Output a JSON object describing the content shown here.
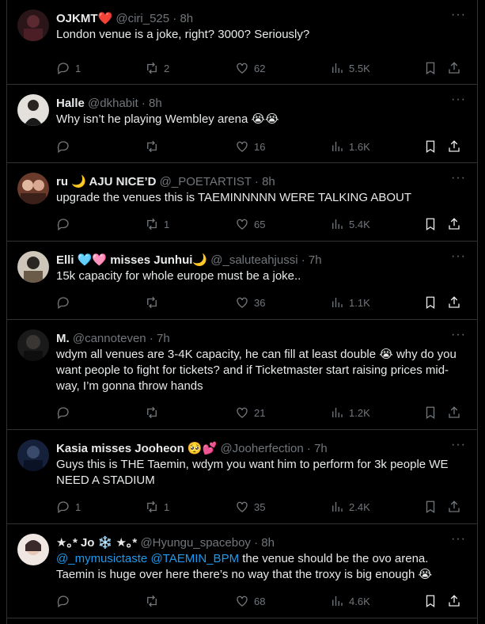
{
  "colors": {
    "background": "#000000",
    "accent": "#1d9bf0",
    "muted": "#71767b",
    "text": "#e7e9ea"
  },
  "more_label": "···",
  "tweets": [
    {
      "name": "OJKMT",
      "name_emoji": "❤️",
      "handle": "@ciri_525",
      "dot": "·",
      "time": "8h",
      "text": "London venue is a joke, right? 3000? Seriously?",
      "replies": "1",
      "retweets": "2",
      "likes": "62",
      "views": "5.5K",
      "avatar_color": "#3a1f24"
    },
    {
      "name": "Halle",
      "name_emoji": "",
      "handle": "@dkhabit",
      "dot": "·",
      "time": "8h",
      "text": "Why isn’t he playing Wembley arena 😭😭",
      "replies": "",
      "retweets": "",
      "likes": "16",
      "views": "1.6K",
      "avatar_color": "#d9d6d2"
    },
    {
      "name": "ru 🌙 AJU NICE’D",
      "name_emoji": "",
      "handle": "@_POETARTIST",
      "dot": "·",
      "time": "8h",
      "text": "upgrade the venues this is TAEMINNNNN WERE TALKING ABOUT",
      "replies": "",
      "retweets": "1",
      "likes": "65",
      "views": "5.4K",
      "avatar_color": "#8a5a4a"
    },
    {
      "name": "Elli 🩵🩷 misses Junhui🌙",
      "name_emoji": "",
      "handle": "@_saluteahjussi",
      "dot": "·",
      "time": "7h",
      "text": "15k capacity for whole europe must be a joke..",
      "replies": "",
      "retweets": "",
      "likes": "36",
      "views": "1.1K",
      "avatar_color": "#c9c0b4"
    },
    {
      "name": "M.",
      "name_emoji": "",
      "handle": "@cannoteven",
      "dot": "·",
      "time": "7h",
      "text": "wdym all venues are 3-4K capacity, he can fill at least double 😭 why do you want people to fight for tickets? and if Ticketmaster start raising prices mid-way, I’m gonna throw hands",
      "replies": "",
      "retweets": "",
      "likes": "21",
      "views": "1.2K",
      "avatar_color": "#2a2a2a"
    },
    {
      "name": "Kasia misses Jooheon 🥺💕",
      "name_emoji": "",
      "handle": "@Jooherfection",
      "dot": "·",
      "time": "7h",
      "text": "Guys this is THE Taemin, wdym you want him to perform for 3k people WE NEED A STADIUM",
      "replies": "1",
      "retweets": "1",
      "likes": "35",
      "views": "2.4K",
      "avatar_color": "#1e2a4a"
    },
    {
      "name": "★｡* Jo ❄️ ★｡*",
      "name_emoji": "",
      "handle": "@Hyungu_spaceboy",
      "dot": "·",
      "time": "8h",
      "mention1": "@_mymusictaste",
      "mention2": "@TAEMIN_BPM",
      "text": " the venue should be the ovo arena. Taemin is huge over here there’s no way that the troxy is big enough 😭",
      "replies": "",
      "retweets": "",
      "likes": "68",
      "views": "4.6K",
      "avatar_color": "#e8dcd6"
    }
  ]
}
